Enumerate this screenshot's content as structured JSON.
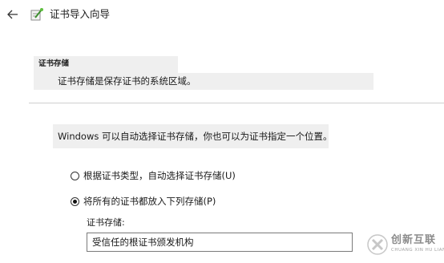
{
  "titlebar": {
    "back_icon": "back-arrow-icon",
    "wizard_icon": "certificate-wizard-icon",
    "title": "证书导入向导"
  },
  "header": {
    "section_title": "证书存储",
    "description": "证书存储是保存证书的系统区域。"
  },
  "main": {
    "intro": "Windows 可以自动选择证书存储，你也可以为证书指定一个位置。",
    "options": [
      {
        "label": "根据证书类型，自动选择证书存储(U)",
        "selected": false
      },
      {
        "label": "将所有的证书都放入下列存储(P)",
        "selected": true
      }
    ],
    "store_label": "证书存储:",
    "store_value": "受信任的根证书颁发机构"
  },
  "watermark": {
    "logo_icon": "watermark-x-logo-icon",
    "text": "创新互联",
    "subtext": "CHUANG XIN HU LIAN"
  }
}
